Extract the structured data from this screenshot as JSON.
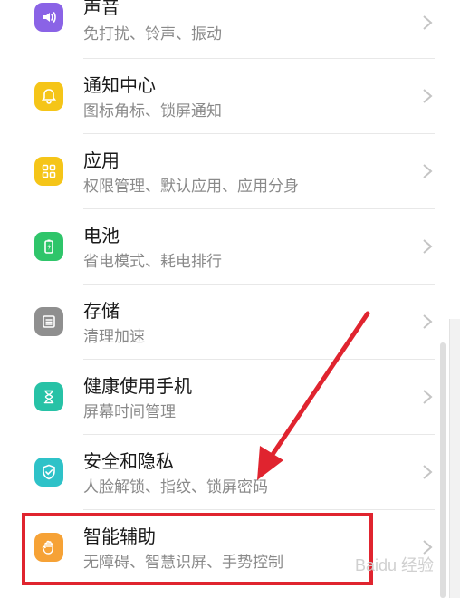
{
  "colors": {
    "purple": "#8a63e6",
    "yellow": "#f5c518",
    "green": "#2fc56a",
    "gray": "#8f8f8f",
    "teal": "#27c2a6",
    "cyan": "#2ec2c8",
    "orange": "#f6a236",
    "highlight": "#e0242f"
  },
  "settings": [
    {
      "title": "声音",
      "subtitle": "免打扰、铃声、振动",
      "icon": "sound-icon"
    },
    {
      "title": "通知中心",
      "subtitle": "图标角标、锁屏通知",
      "icon": "bell-icon"
    },
    {
      "title": "应用",
      "subtitle": "权限管理、默认应用、应用分身",
      "icon": "apps-grid-icon"
    },
    {
      "title": "电池",
      "subtitle": "省电模式、耗电排行",
      "icon": "battery-icon"
    },
    {
      "title": "存储",
      "subtitle": "清理加速",
      "icon": "storage-icon"
    },
    {
      "title": "健康使用手机",
      "subtitle": "屏幕时间管理",
      "icon": "hourglass-icon"
    },
    {
      "title": "安全和隐私",
      "subtitle": "人脸解锁、指纹、锁屏密码",
      "icon": "shield-icon"
    },
    {
      "title": "智能辅助",
      "subtitle": "无障碍、智慧识屏、手势控制",
      "icon": "hand-icon"
    }
  ],
  "watermark": "Baidu 经验"
}
